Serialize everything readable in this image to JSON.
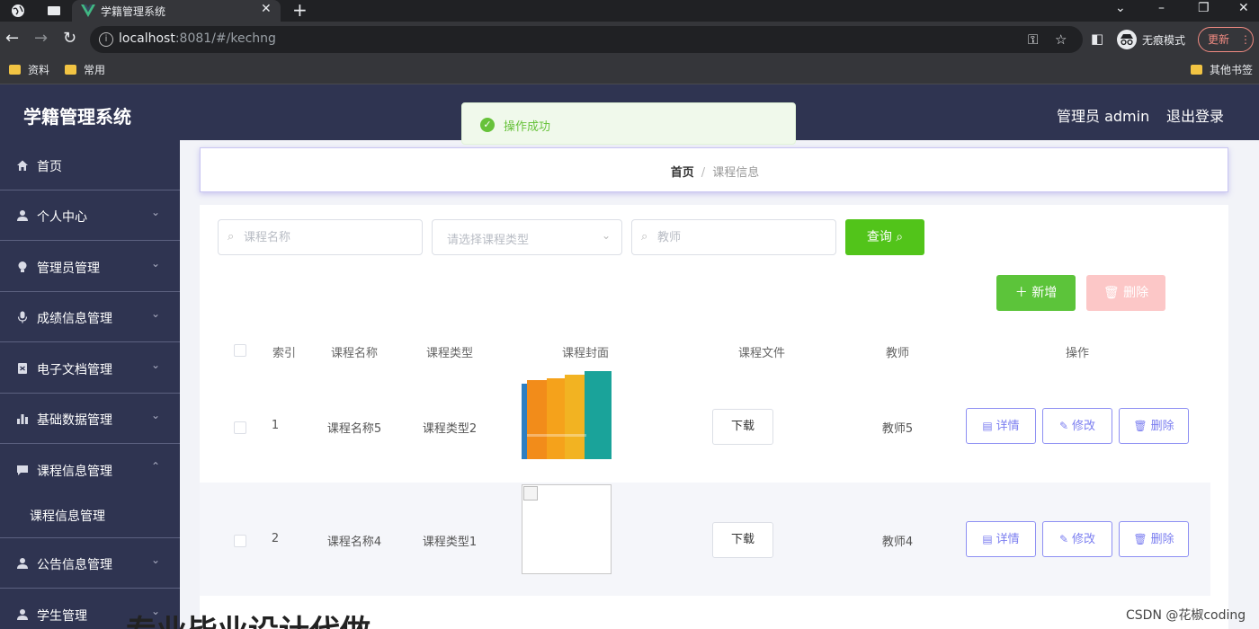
{
  "browser": {
    "tab_title": "学籍管理系统",
    "url_host": "localhost",
    "url_rest": ":8081/#/kechng",
    "incognito_label": "无痕模式",
    "update_label": "更新",
    "bookmarks": [
      "资料",
      "常用"
    ],
    "other_bookmarks": "其他书签"
  },
  "app": {
    "title": "学籍管理系统",
    "admin_label": "管理员 admin",
    "logout": "退出登录"
  },
  "sidebar": {
    "items": [
      {
        "label": "首页",
        "icon": "home-icon"
      },
      {
        "label": "个人中心",
        "icon": "user-icon"
      },
      {
        "label": "管理员管理",
        "icon": "bulb-icon"
      },
      {
        "label": "成绩信息管理",
        "icon": "mic-icon"
      },
      {
        "label": "电子文档管理",
        "icon": "document-icon"
      },
      {
        "label": "基础数据管理",
        "icon": "bar-chart-icon"
      },
      {
        "label": "课程信息管理",
        "icon": "message-icon"
      },
      {
        "label": "公告信息管理",
        "icon": "user-icon"
      },
      {
        "label": "学生管理",
        "icon": "user-icon"
      }
    ],
    "sub_item": "课程信息管理"
  },
  "breadcrumb": {
    "home": "首页",
    "separator": "/",
    "current": "课程信息"
  },
  "search": {
    "name_placeholder": "课程名称",
    "type_placeholder": "请选择课程类型",
    "teacher_placeholder": "教师",
    "query_label": "查询"
  },
  "actions": {
    "add_label": "新增",
    "delete_label": "删除"
  },
  "table": {
    "headers": [
      "索引",
      "课程名称",
      "课程类型",
      "课程封面",
      "课程文件",
      "教师",
      "操作"
    ],
    "download_label": "下载",
    "detail_label": "详情",
    "edit_label": "修改",
    "delete_label": "删除",
    "rows": [
      {
        "index": "1",
        "name": "课程名称5",
        "type": "课程类型2",
        "teacher": "教师5"
      },
      {
        "index": "2",
        "name": "课程名称4",
        "type": "课程类型1",
        "teacher": "教师4"
      }
    ]
  },
  "toast": {
    "message": "操作成功"
  },
  "watermark": "CSDN @花椒coding",
  "bottom_overlay": "专业毕业设计代做",
  "colors": {
    "header_bg": "#2f3451",
    "query_green": "#52c41a",
    "delete_pink": "#fcc7c7",
    "action_purple": "#7b7ef0",
    "toast_green": "#67c23a"
  }
}
